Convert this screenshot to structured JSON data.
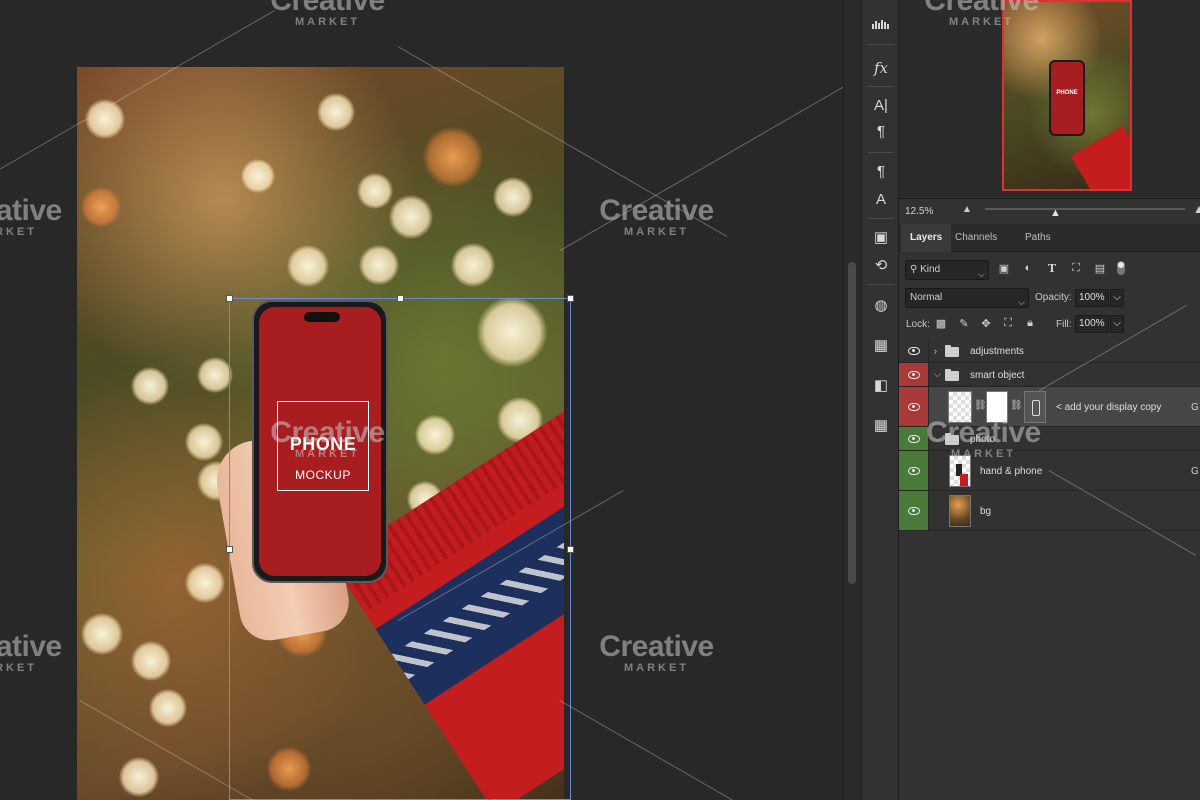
{
  "document": {
    "mockup_title": "PHONE",
    "mockup_subtitle": "MOCKUP"
  },
  "watermark": {
    "main": "Creative",
    "sub": "MARKET"
  },
  "navigator": {
    "zoom": "12.5%",
    "thumb_label": "PHONE"
  },
  "tool_strip": {
    "icons": [
      "histogram-icon",
      "fx-icon",
      "character-icon",
      "paragraph-icon",
      "paragraph-styles-icon",
      "character-styles-icon",
      "libraries-icon",
      "history-icon",
      "color-icon",
      "swatches-icon",
      "gradient-icon",
      "patterns-icon"
    ]
  },
  "layers_panel": {
    "tabs": [
      "Layers",
      "Channels",
      "Paths"
    ],
    "active_tab": "Layers",
    "filter_kind": "Kind",
    "blend_mode": "Normal",
    "opacity_label": "Opacity:",
    "opacity": "100%",
    "lock_label": "Lock:",
    "fill_label": "Fill:",
    "fill": "100%",
    "layers": [
      {
        "name": "adjustments",
        "type": "group",
        "expanded": false,
        "eye_color": "none"
      },
      {
        "name": "smart object",
        "type": "group",
        "expanded": true,
        "eye_color": "#a83a3a"
      },
      {
        "name": "< add your display copy",
        "type": "smart-object",
        "selected": true,
        "eye_color": "#a83a3a"
      },
      {
        "name": "photo",
        "type": "group",
        "expanded": true,
        "eye_color": "#4a7a3a"
      },
      {
        "name": "hand & phone",
        "type": "layer",
        "eye_color": "#4a7a3a"
      },
      {
        "name": "bg",
        "type": "layer",
        "eye_color": "#4a7a3a"
      }
    ],
    "truncated_suffix": "G"
  },
  "colors": {
    "mockup_screen": "#a81e20",
    "selection_box": "#6a8bd8",
    "panel_bg": "#323232",
    "canvas_bg": "#282828"
  }
}
